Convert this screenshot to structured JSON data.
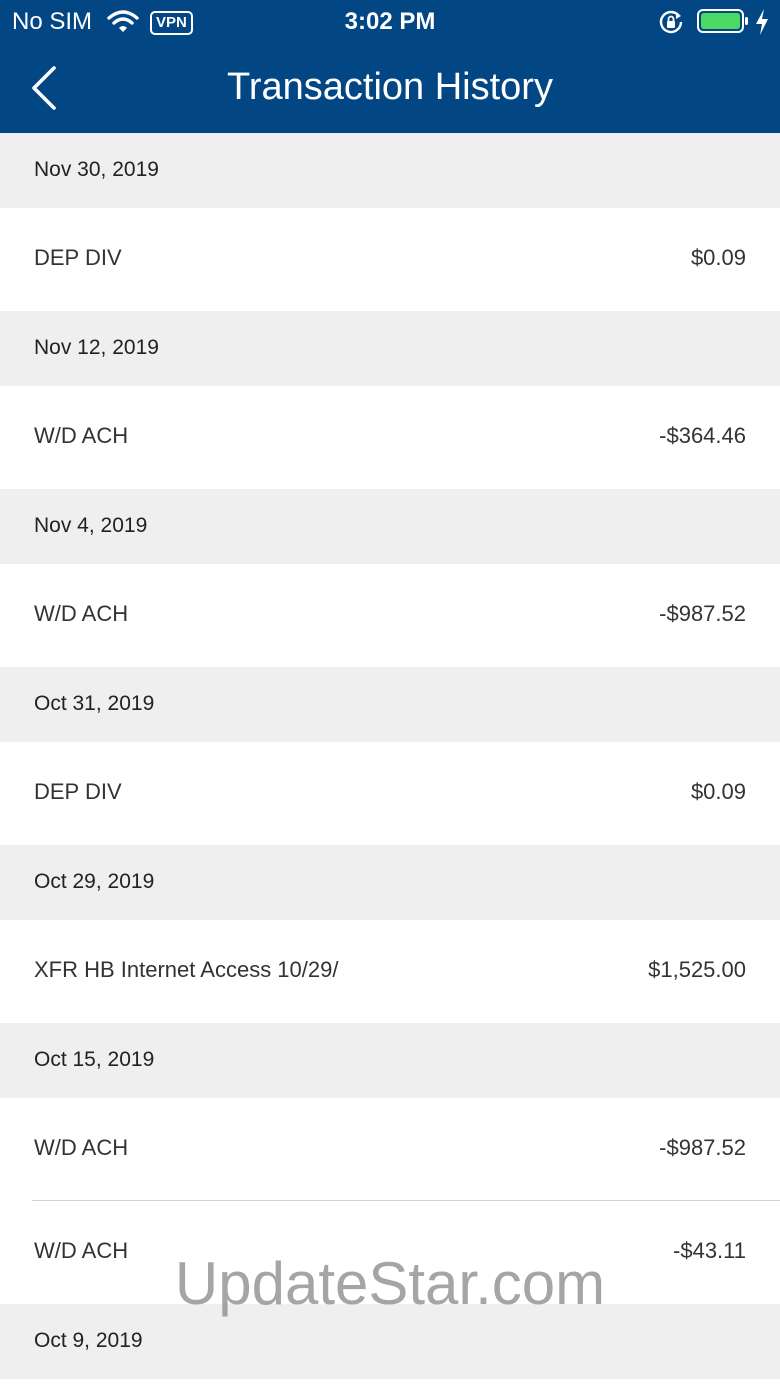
{
  "status_bar": {
    "carrier": "No SIM",
    "vpn": "VPN",
    "time": "3:02 PM"
  },
  "nav": {
    "title": "Transaction History"
  },
  "groups": [
    {
      "date": "Nov 30, 2019",
      "transactions": [
        {
          "description": "DEP DIV",
          "amount": "$0.09"
        }
      ]
    },
    {
      "date": "Nov 12, 2019",
      "transactions": [
        {
          "description": "W/D ACH",
          "amount": "-$364.46"
        }
      ]
    },
    {
      "date": "Nov 4, 2019",
      "transactions": [
        {
          "description": "W/D ACH",
          "amount": "-$987.52"
        }
      ]
    },
    {
      "date": "Oct 31, 2019",
      "transactions": [
        {
          "description": "DEP DIV",
          "amount": "$0.09"
        }
      ]
    },
    {
      "date": "Oct 29, 2019",
      "transactions": [
        {
          "description": "XFR HB Internet Access 10/29/",
          "amount": "$1,525.00"
        }
      ]
    },
    {
      "date": "Oct 15, 2019",
      "transactions": [
        {
          "description": "W/D ACH",
          "amount": "-$987.52"
        },
        {
          "description": "W/D ACH",
          "amount": "-$43.11"
        }
      ]
    },
    {
      "date": "Oct 9, 2019",
      "transactions": []
    }
  ],
  "watermark": "UpdateStar.com",
  "colors": {
    "header_bg": "#024784",
    "date_row_bg": "#efeff0",
    "battery": "#4cd964"
  }
}
